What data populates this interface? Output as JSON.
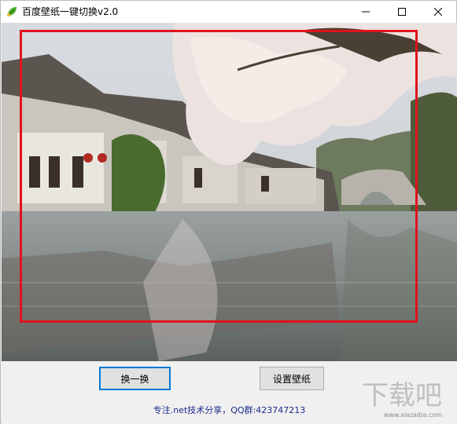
{
  "window": {
    "title": "百度壁纸一键切换v2.0"
  },
  "buttons": {
    "switch_label": "换一换",
    "set_wallpaper_label": "设置壁纸"
  },
  "footer": {
    "text": "专注.net技术分享，QQ群:423747213"
  },
  "watermark": {
    "text": "下载吧",
    "url": "www.xiazaiba.com"
  },
  "colors": {
    "selection_frame": "#e0131d",
    "footer_text": "#1a2a8c",
    "focus_border": "#0078d7"
  },
  "icons": [
    "app-leaf-icon",
    "minimize-icon",
    "maximize-icon",
    "close-icon"
  ]
}
